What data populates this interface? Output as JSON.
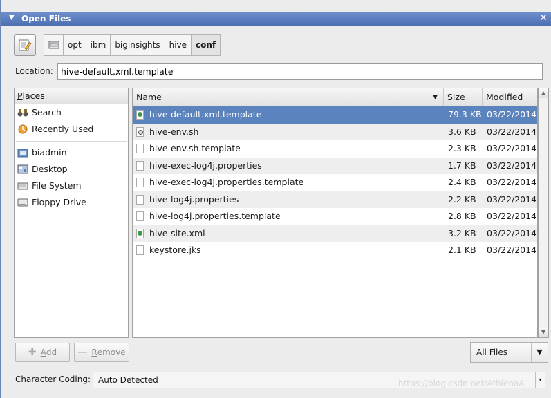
{
  "window": {
    "title": "Open Files"
  },
  "pathbar": {
    "crumbs": [
      "opt",
      "ibm",
      "biginsights",
      "hive",
      "conf"
    ]
  },
  "location": {
    "label_pre": "",
    "label_key": "L",
    "label_post": "ocation:",
    "value": "hive-default.xml.template"
  },
  "places": {
    "header_key": "P",
    "header_rest": "laces",
    "items": [
      "Search",
      "Recently Used",
      "biadmin",
      "Desktop",
      "File System",
      "Floppy Drive"
    ]
  },
  "files": {
    "columns": {
      "name": "Name",
      "size": "Size",
      "modified": "Modified"
    },
    "rows": [
      {
        "name": "hive-default.xml.template",
        "size": "79.3 KB",
        "modified": "03/22/2014",
        "icon": "xml"
      },
      {
        "name": "hive-env.sh",
        "size": "3.6 KB",
        "modified": "03/22/2014",
        "icon": "gear"
      },
      {
        "name": "hive-env.sh.template",
        "size": "2.3 KB",
        "modified": "03/22/2014",
        "icon": "doc"
      },
      {
        "name": "hive-exec-log4j.properties",
        "size": "1.7 KB",
        "modified": "03/22/2014",
        "icon": "doc"
      },
      {
        "name": "hive-exec-log4j.properties.template",
        "size": "2.4 KB",
        "modified": "03/22/2014",
        "icon": "doc"
      },
      {
        "name": "hive-log4j.properties",
        "size": "2.2 KB",
        "modified": "03/22/2014",
        "icon": "doc"
      },
      {
        "name": "hive-log4j.properties.template",
        "size": "2.8 KB",
        "modified": "03/22/2014",
        "icon": "doc"
      },
      {
        "name": "hive-site.xml",
        "size": "3.2 KB",
        "modified": "03/22/2014",
        "icon": "xml"
      },
      {
        "name": "keystore.jks",
        "size": "2.1 KB",
        "modified": "03/22/2014",
        "icon": "doc"
      }
    ]
  },
  "buttons": {
    "add_key": "A",
    "add_rest": "dd",
    "remove_key": "R",
    "remove_rest": "emove"
  },
  "filter": {
    "selected": "All Files"
  },
  "coding": {
    "label_pre": "C",
    "label_key": "h",
    "label_post": "aracter Coding:",
    "value": "Auto Detected"
  },
  "watermark": "https://blog.csdn.net/AthlenaA",
  "colors": {
    "selection": "#5b83bd",
    "titlebar": "#5c7ec0"
  }
}
